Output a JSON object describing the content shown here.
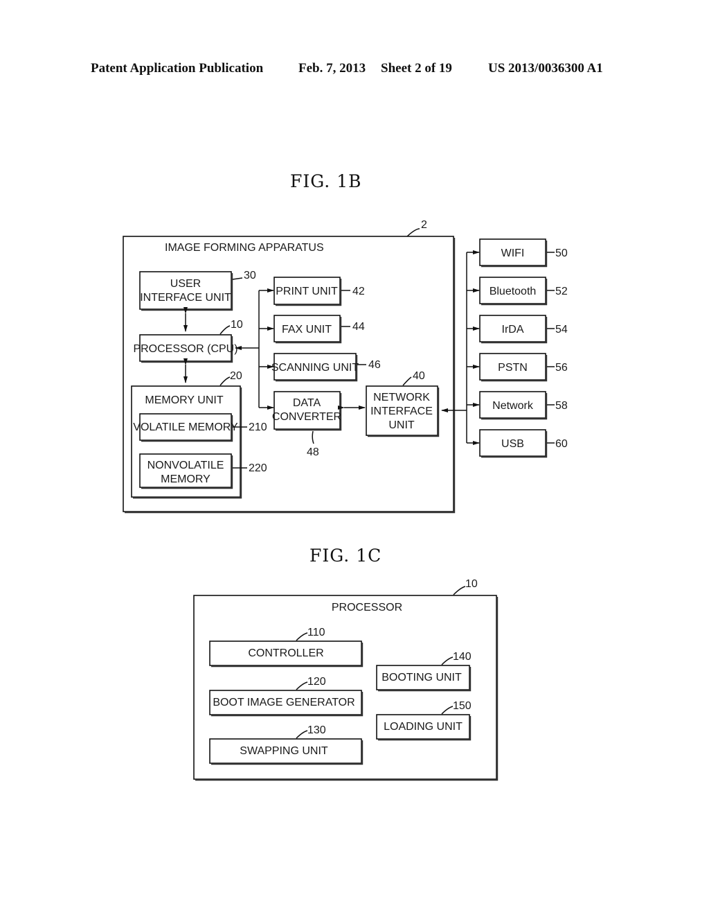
{
  "header": {
    "publication": "Patent Application Publication",
    "date": "Feb. 7, 2013",
    "sheet": "Sheet 2 of 19",
    "number": "US 2013/0036300 A1"
  },
  "fig1b": {
    "title": "FIG.  1B",
    "container": {
      "label": "IMAGE FORMING APPARATUS",
      "ref": "2"
    },
    "user_interface": {
      "line1": "USER",
      "line2": "INTERFACE UNIT",
      "ref": "30"
    },
    "processor": {
      "label": "PROCESSOR (CPU)",
      "ref": "10"
    },
    "memory": {
      "label": "MEMORY UNIT",
      "ref": "20",
      "volatile": {
        "label": "VOLATILE MEMORY",
        "ref": "210"
      },
      "nonvolatile": {
        "line1": "NONVOLATILE",
        "line2": "MEMORY",
        "ref": "220"
      }
    },
    "print": {
      "label": "PRINT UNIT",
      "ref": "42"
    },
    "fax": {
      "label": "FAX UNIT",
      "ref": "44"
    },
    "scanning": {
      "label": "SCANNING UNIT",
      "ref": "46"
    },
    "data_converter": {
      "line1": "DATA",
      "line2": "CONVERTER",
      "ref": "48"
    },
    "network_interface": {
      "line1": "NETWORK",
      "line2": "INTERFACE",
      "line3": "UNIT",
      "ref": "40"
    },
    "externals": [
      {
        "label": "WIFI",
        "ref": "50"
      },
      {
        "label": "Bluetooth",
        "ref": "52"
      },
      {
        "label": "IrDA",
        "ref": "54"
      },
      {
        "label": "PSTN",
        "ref": "56"
      },
      {
        "label": "Network",
        "ref": "58"
      },
      {
        "label": "USB",
        "ref": "60"
      }
    ]
  },
  "fig1c": {
    "title": "FIG.  1C",
    "container": {
      "label": "PROCESSOR",
      "ref": "10"
    },
    "controller": {
      "label": "CONTROLLER",
      "ref": "110"
    },
    "boot_image_generator": {
      "label": "BOOT IMAGE GENERATOR",
      "ref": "120"
    },
    "swapping": {
      "label": "SWAPPING UNIT",
      "ref": "130"
    },
    "booting": {
      "label": "BOOTING UNIT",
      "ref": "140"
    },
    "loading": {
      "label": "LOADING UNIT",
      "ref": "150"
    }
  }
}
